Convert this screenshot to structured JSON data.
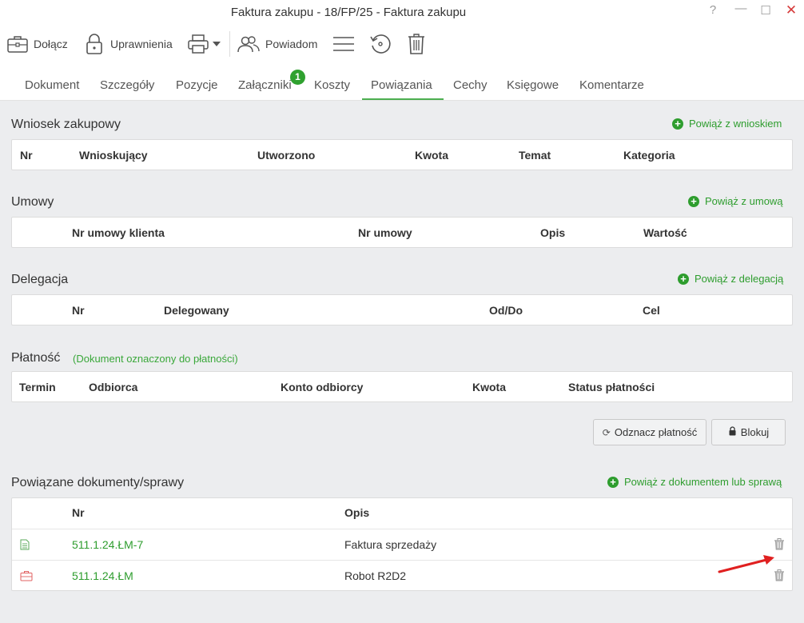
{
  "window": {
    "title": "Faktura zakupu - 18/FP/25 - Faktura zakupu",
    "help": "?",
    "minimize": "—",
    "maximize": "☐",
    "close": "✕"
  },
  "toolbar": {
    "attach_label": "Dołącz",
    "permissions_label": "Uprawnienia",
    "notify_label": "Powiadom"
  },
  "tabs": [
    {
      "label": "Dokument"
    },
    {
      "label": "Szczegóły"
    },
    {
      "label": "Pozycje"
    },
    {
      "label": "Załączniki"
    },
    {
      "label": "Koszty"
    },
    {
      "label": "Powiązania"
    },
    {
      "label": "Cechy"
    },
    {
      "label": "Księgowe"
    },
    {
      "label": "Komentarze"
    }
  ],
  "attachments_badge": "1",
  "active_tab": "Powiązania",
  "purchase_request": {
    "title": "Wniosek zakupowy",
    "link": "Powiąż z wnioskiem",
    "columns": [
      "Nr",
      "Wnioskujący",
      "Utworzono",
      "Kwota",
      "Temat",
      "Kategoria"
    ]
  },
  "contracts": {
    "title": "Umowy",
    "link": "Powiąż z umową",
    "columns": [
      "Nr umowy klienta",
      "Nr umowy",
      "Opis",
      "Wartość"
    ]
  },
  "delegation": {
    "title": "Delegacja",
    "link": "Powiąż z delegacją",
    "columns": [
      "Nr",
      "Delegowany",
      "Od/Do",
      "Cel"
    ]
  },
  "payment": {
    "title": "Płatność",
    "note": "(Dokument oznaczony do płatności)",
    "columns": [
      "Termin",
      "Odbiorca",
      "Konto odbiorcy",
      "Kwota",
      "Status płatności"
    ],
    "unmark_button": "Odznacz płatność",
    "block_button": "Blokuj"
  },
  "related": {
    "title": "Powiązane dokumenty/sprawy",
    "link": "Powiąż z dokumentem lub sprawą",
    "columns": [
      "Nr",
      "Opis"
    ],
    "rows": [
      {
        "nr": "511.1.24.ŁM-7",
        "opis": "Faktura sprzedaży",
        "icon": "document-icon"
      },
      {
        "nr": "511.1.24.ŁM",
        "opis": "Robot R2D2",
        "icon": "case-icon"
      }
    ]
  },
  "colors": {
    "accent_green": "#2e9d2e",
    "tab_underline": "#4caf50",
    "close_red": "#d63a3a",
    "annotation_arrow": "#e02020"
  }
}
